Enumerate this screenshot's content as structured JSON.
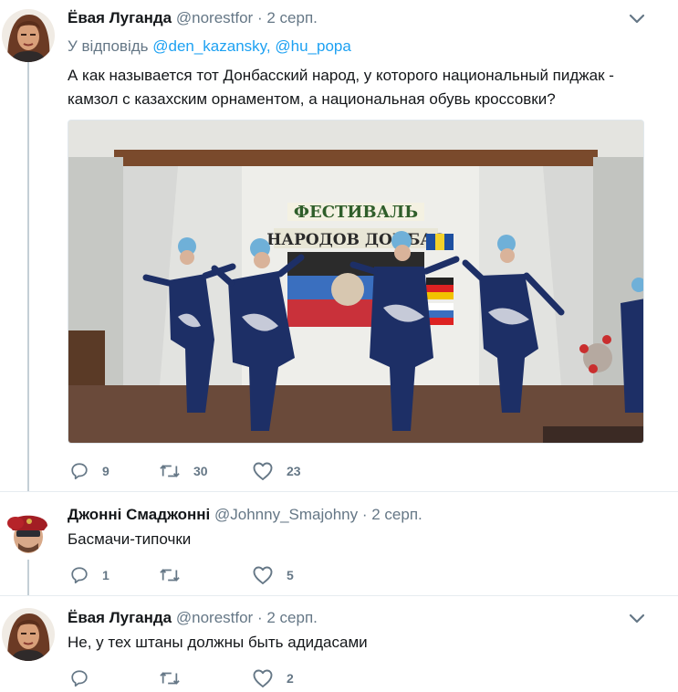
{
  "tweets": [
    {
      "name": "Ёвая Луганда",
      "handle": "@norestfor",
      "date": "· 2 серп.",
      "reply_prefix": "У відповідь",
      "reply_mentions": [
        "@den_kazansky",
        "@hu_popa"
      ],
      "text_line1": "А как называется тот Донбасский народ, у которого национальный пиджак -",
      "text_line2": "камзол с казахским орнаментом, а национальная обувь кроссовки?",
      "banner_line1": "ФЕСТИВАЛЬ",
      "banner_line2": "НАРОДОВ ДОНБАС",
      "replies": "9",
      "retweets": "30",
      "likes": "23"
    },
    {
      "name": "Джонні Смаджонні",
      "handle": "@Johnny_Smajohny",
      "date": "· 2 серп.",
      "text": "Басмачи-типочки",
      "replies": "1",
      "retweets": "",
      "likes": "5"
    },
    {
      "name": "Ёвая Луганда",
      "handle": "@norestfor",
      "date": "· 2 серп.",
      "text": "Не, у тех штаны должны быть адидасами",
      "replies": "",
      "retweets": "",
      "likes": "2"
    }
  ],
  "colors": {
    "link": "#1da1f2",
    "secondary": "#657786",
    "thread_line": "#c4cfd6",
    "divider": "#e6ecf0"
  },
  "icons": [
    "reply-icon",
    "retweet-icon",
    "like-icon",
    "chevron-down-icon"
  ]
}
